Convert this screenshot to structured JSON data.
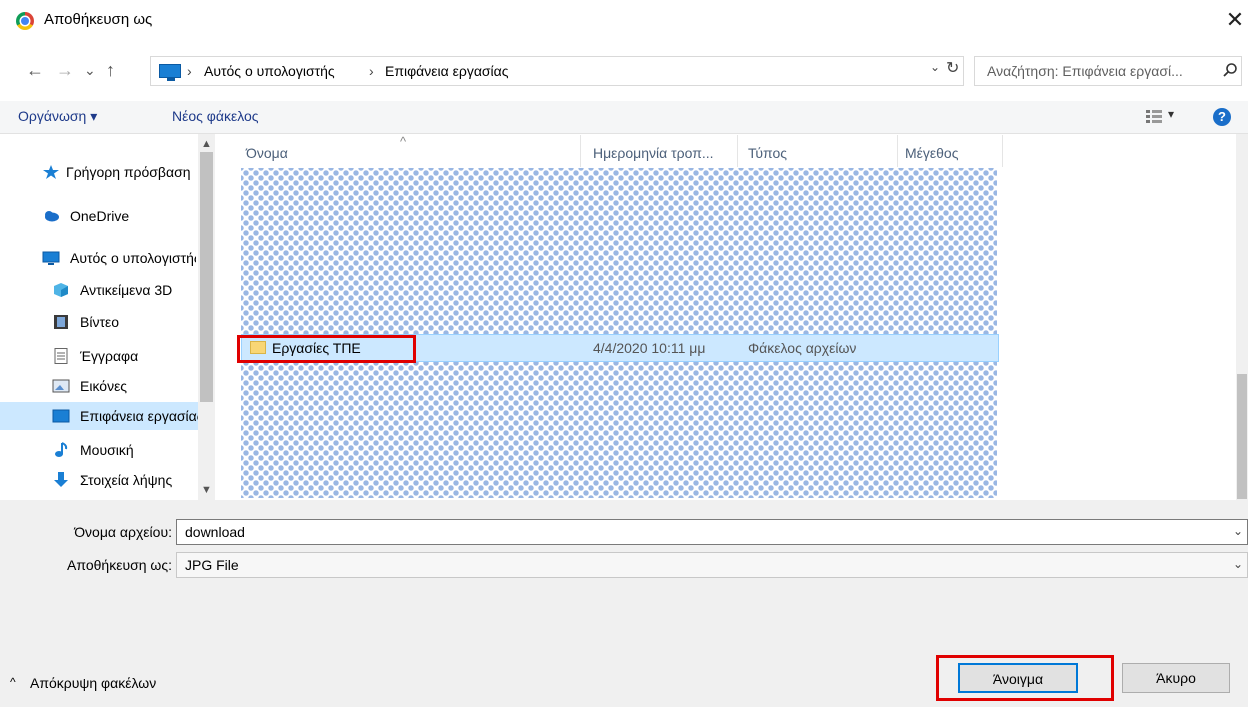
{
  "window": {
    "title": "Αποθήκευση ως",
    "close_glyph": "✕"
  },
  "nav": {
    "back": "←",
    "forward": "→",
    "recent": "⌄",
    "up": "↑",
    "breadcrumb": [
      "Αυτός ο υπολογιστής",
      "Επιφάνεια εργασίας"
    ],
    "separator": "›",
    "dropdown": "⌄",
    "refresh": "↻",
    "search_placeholder": "Αναζήτηση: Επιφάνεια εργασί..."
  },
  "toolbar": {
    "organize": "Οργάνωση ▾",
    "new_folder": "Νέος φάκελος",
    "view_dd": "▾",
    "help": "?"
  },
  "sidebar": {
    "items": [
      {
        "label": "Γρήγορη πρόσβαση",
        "icon": "star-icon"
      },
      {
        "label": "OneDrive",
        "icon": "cloud-icon"
      },
      {
        "label": "Αυτός ο υπολογιστής",
        "icon": "computer-icon"
      },
      {
        "label": "Αντικείμενα 3D",
        "icon": "cube-icon"
      },
      {
        "label": "Βίντεο",
        "icon": "video-icon"
      },
      {
        "label": "Έγγραφα",
        "icon": "document-icon"
      },
      {
        "label": "Εικόνες",
        "icon": "pictures-icon"
      },
      {
        "label": "Επιφάνεια εργασίας",
        "icon": "desktop-icon"
      },
      {
        "label": "Μουσική",
        "icon": "music-icon"
      },
      {
        "label": "Στοιχεία λήψης",
        "icon": "download-icon"
      }
    ],
    "selected": "Επιφάνεια εργασίας"
  },
  "columns": {
    "name": "Όνομα",
    "date": "Ημερομηνία τροπ...",
    "type": "Τύπος",
    "size": "Μέγεθος",
    "sort_glyph": "^"
  },
  "files": [
    {
      "name": "Εργασίες ΤΠΕ",
      "date": "4/4/2020 10:11 μμ",
      "type": "Φάκελος αρχείων",
      "size": ""
    }
  ],
  "form": {
    "filename_label": "Όνομα αρχείου:",
    "filename_value": "download",
    "savetype_label": "Αποθήκευση ως:",
    "savetype_value": "JPG File"
  },
  "footer": {
    "hide_folders": "Απόκρυψη φακέλων",
    "open_button": "Άνοιγμα",
    "cancel_button": "Άκυρο"
  },
  "colors": {
    "highlight": "#e00000",
    "selection": "#cce8ff",
    "accent": "#0078d7"
  }
}
